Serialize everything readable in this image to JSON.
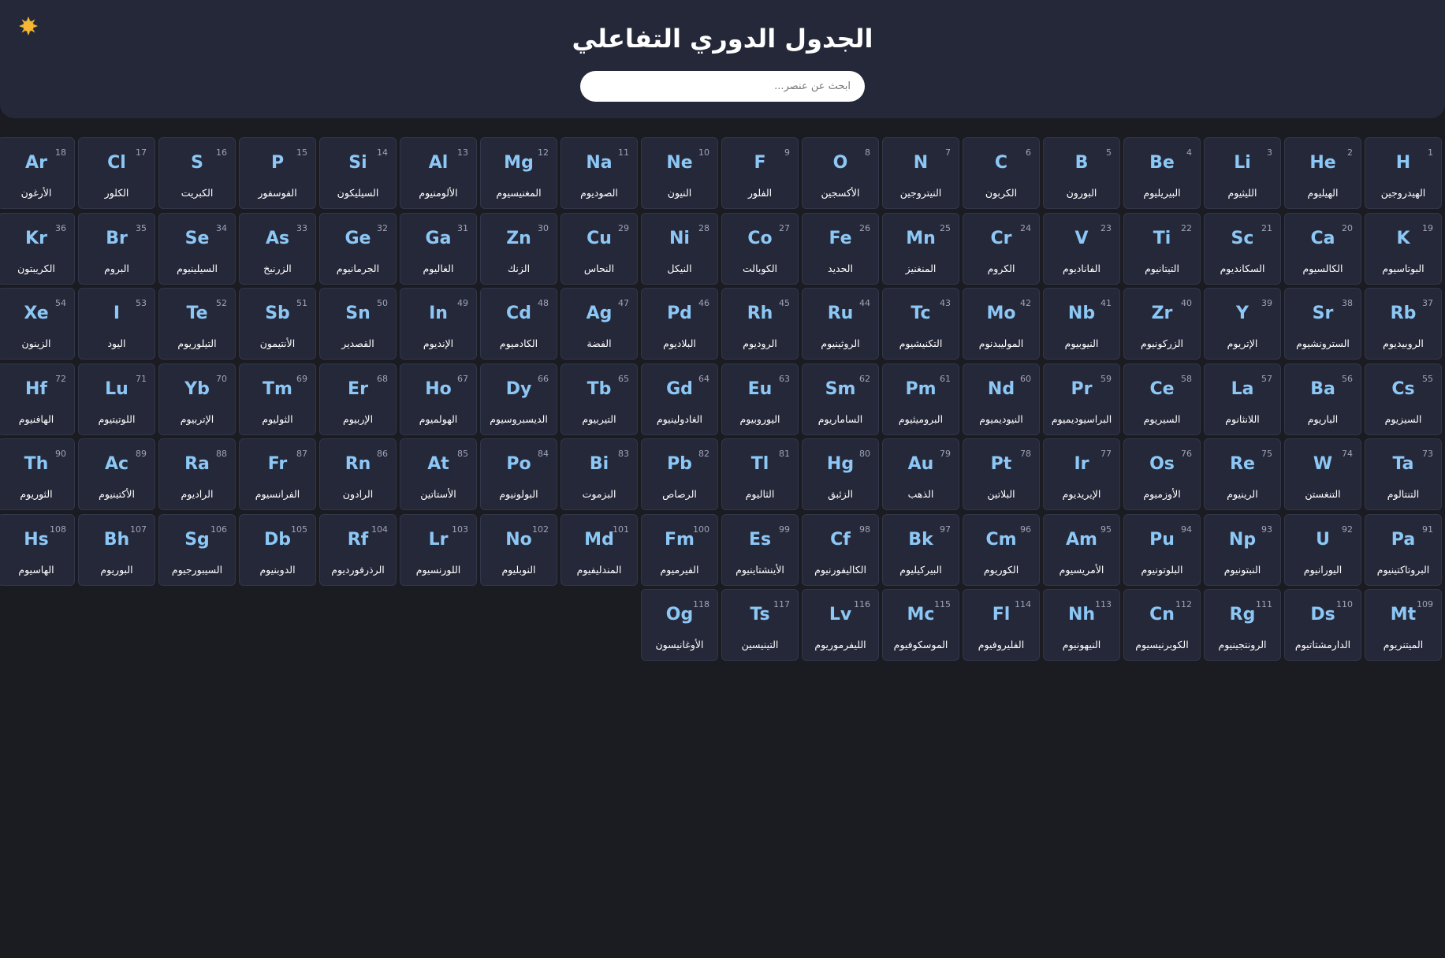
{
  "header": {
    "title": "الجدول الدوري التفاعلي",
    "search_placeholder": "ابحث عن عنصر...",
    "theme_toggle_icon": "sun-icon",
    "accent_color": "#f5b833"
  },
  "colors": {
    "background": "#1b1c22",
    "panel": "#252839",
    "symbol": "#8cc7f5",
    "number": "#a0a4b8"
  },
  "elements": [
    {
      "n": "1",
      "s": "H",
      "a": "الهيدروجين"
    },
    {
      "n": "2",
      "s": "He",
      "a": "الهيليوم"
    },
    {
      "n": "3",
      "s": "Li",
      "a": "الليثيوم"
    },
    {
      "n": "4",
      "s": "Be",
      "a": "البيريليوم"
    },
    {
      "n": "5",
      "s": "B",
      "a": "البورون"
    },
    {
      "n": "6",
      "s": "C",
      "a": "الكربون"
    },
    {
      "n": "7",
      "s": "N",
      "a": "النيتروجين"
    },
    {
      "n": "8",
      "s": "O",
      "a": "الأكسجين"
    },
    {
      "n": "9",
      "s": "F",
      "a": "الفلور"
    },
    {
      "n": "10",
      "s": "Ne",
      "a": "النيون"
    },
    {
      "n": "11",
      "s": "Na",
      "a": "الصوديوم"
    },
    {
      "n": "12",
      "s": "Mg",
      "a": "المغنيسيوم"
    },
    {
      "n": "13",
      "s": "Al",
      "a": "الألومنيوم"
    },
    {
      "n": "14",
      "s": "Si",
      "a": "السيليكون"
    },
    {
      "n": "15",
      "s": "P",
      "a": "الفوسفور"
    },
    {
      "n": "16",
      "s": "S",
      "a": "الكبريت"
    },
    {
      "n": "17",
      "s": "Cl",
      "a": "الكلور"
    },
    {
      "n": "18",
      "s": "Ar",
      "a": "الأرغون"
    },
    {
      "n": "19",
      "s": "K",
      "a": "البوتاسيوم"
    },
    {
      "n": "20",
      "s": "Ca",
      "a": "الكالسيوم"
    },
    {
      "n": "21",
      "s": "Sc",
      "a": "السكانديوم"
    },
    {
      "n": "22",
      "s": "Ti",
      "a": "التيتانيوم"
    },
    {
      "n": "23",
      "s": "V",
      "a": "الفاناديوم"
    },
    {
      "n": "24",
      "s": "Cr",
      "a": "الكروم"
    },
    {
      "n": "25",
      "s": "Mn",
      "a": "المنغنيز"
    },
    {
      "n": "26",
      "s": "Fe",
      "a": "الحديد"
    },
    {
      "n": "27",
      "s": "Co",
      "a": "الكوبالت"
    },
    {
      "n": "28",
      "s": "Ni",
      "a": "النيكل"
    },
    {
      "n": "29",
      "s": "Cu",
      "a": "النحاس"
    },
    {
      "n": "30",
      "s": "Zn",
      "a": "الزنك"
    },
    {
      "n": "31",
      "s": "Ga",
      "a": "الغاليوم"
    },
    {
      "n": "32",
      "s": "Ge",
      "a": "الجرمانيوم"
    },
    {
      "n": "33",
      "s": "As",
      "a": "الزرنيخ"
    },
    {
      "n": "34",
      "s": "Se",
      "a": "السيلينيوم"
    },
    {
      "n": "35",
      "s": "Br",
      "a": "البروم"
    },
    {
      "n": "36",
      "s": "Kr",
      "a": "الكريبتون"
    },
    {
      "n": "37",
      "s": "Rb",
      "a": "الروبيديوم"
    },
    {
      "n": "38",
      "s": "Sr",
      "a": "السترونشيوم"
    },
    {
      "n": "39",
      "s": "Y",
      "a": "الإتريوم"
    },
    {
      "n": "40",
      "s": "Zr",
      "a": "الزركونيوم"
    },
    {
      "n": "41",
      "s": "Nb",
      "a": "النيوبيوم"
    },
    {
      "n": "42",
      "s": "Mo",
      "a": "الموليبدنوم"
    },
    {
      "n": "43",
      "s": "Tc",
      "a": "التكنيشيوم"
    },
    {
      "n": "44",
      "s": "Ru",
      "a": "الروثينيوم"
    },
    {
      "n": "45",
      "s": "Rh",
      "a": "الروديوم"
    },
    {
      "n": "46",
      "s": "Pd",
      "a": "البلاديوم"
    },
    {
      "n": "47",
      "s": "Ag",
      "a": "الفضة"
    },
    {
      "n": "48",
      "s": "Cd",
      "a": "الكادميوم"
    },
    {
      "n": "49",
      "s": "In",
      "a": "الإنديوم"
    },
    {
      "n": "50",
      "s": "Sn",
      "a": "القصدير"
    },
    {
      "n": "51",
      "s": "Sb",
      "a": "الأنتيمون"
    },
    {
      "n": "52",
      "s": "Te",
      "a": "التيلوريوم"
    },
    {
      "n": "53",
      "s": "I",
      "a": "اليود"
    },
    {
      "n": "54",
      "s": "Xe",
      "a": "الزينون"
    },
    {
      "n": "55",
      "s": "Cs",
      "a": "السيزيوم"
    },
    {
      "n": "56",
      "s": "Ba",
      "a": "الباريوم"
    },
    {
      "n": "57",
      "s": "La",
      "a": "اللانثانوم"
    },
    {
      "n": "58",
      "s": "Ce",
      "a": "السيريوم"
    },
    {
      "n": "59",
      "s": "Pr",
      "a": "البراسيوديميوم"
    },
    {
      "n": "60",
      "s": "Nd",
      "a": "النيوديميوم"
    },
    {
      "n": "61",
      "s": "Pm",
      "a": "البروميثيوم"
    },
    {
      "n": "62",
      "s": "Sm",
      "a": "الساماريوم"
    },
    {
      "n": "63",
      "s": "Eu",
      "a": "اليوروبيوم"
    },
    {
      "n": "64",
      "s": "Gd",
      "a": "الغادولينيوم"
    },
    {
      "n": "65",
      "s": "Tb",
      "a": "التيربيوم"
    },
    {
      "n": "66",
      "s": "Dy",
      "a": "الديسبروسيوم"
    },
    {
      "n": "67",
      "s": "Ho",
      "a": "الهولميوم"
    },
    {
      "n": "68",
      "s": "Er",
      "a": "الإربيوم"
    },
    {
      "n": "69",
      "s": "Tm",
      "a": "الثوليوم"
    },
    {
      "n": "70",
      "s": "Yb",
      "a": "الإتربيوم"
    },
    {
      "n": "71",
      "s": "Lu",
      "a": "اللوتيتيوم"
    },
    {
      "n": "72",
      "s": "Hf",
      "a": "الهافنيوم"
    },
    {
      "n": "73",
      "s": "Ta",
      "a": "التنتالوم"
    },
    {
      "n": "74",
      "s": "W",
      "a": "التنغستن"
    },
    {
      "n": "75",
      "s": "Re",
      "a": "الرينيوم"
    },
    {
      "n": "76",
      "s": "Os",
      "a": "الأوزميوم"
    },
    {
      "n": "77",
      "s": "Ir",
      "a": "الإيريديوم"
    },
    {
      "n": "78",
      "s": "Pt",
      "a": "البلاتين"
    },
    {
      "n": "79",
      "s": "Au",
      "a": "الذهب"
    },
    {
      "n": "80",
      "s": "Hg",
      "a": "الزئبق"
    },
    {
      "n": "81",
      "s": "Tl",
      "a": "الثاليوم"
    },
    {
      "n": "82",
      "s": "Pb",
      "a": "الرصاص"
    },
    {
      "n": "83",
      "s": "Bi",
      "a": "البزموت"
    },
    {
      "n": "84",
      "s": "Po",
      "a": "البولونيوم"
    },
    {
      "n": "85",
      "s": "At",
      "a": "الأستاتين"
    },
    {
      "n": "86",
      "s": "Rn",
      "a": "الرادون"
    },
    {
      "n": "87",
      "s": "Fr",
      "a": "الفرانسيوم"
    },
    {
      "n": "88",
      "s": "Ra",
      "a": "الراديوم"
    },
    {
      "n": "89",
      "s": "Ac",
      "a": "الأكتينيوم"
    },
    {
      "n": "90",
      "s": "Th",
      "a": "الثوريوم"
    },
    {
      "n": "91",
      "s": "Pa",
      "a": "البروتاكتينيوم"
    },
    {
      "n": "92",
      "s": "U",
      "a": "اليورانيوم"
    },
    {
      "n": "93",
      "s": "Np",
      "a": "النبتونيوم"
    },
    {
      "n": "94",
      "s": "Pu",
      "a": "البلوتونيوم"
    },
    {
      "n": "95",
      "s": "Am",
      "a": "الأمريسيوم"
    },
    {
      "n": "96",
      "s": "Cm",
      "a": "الكوريوم"
    },
    {
      "n": "97",
      "s": "Bk",
      "a": "البيركيليوم"
    },
    {
      "n": "98",
      "s": "Cf",
      "a": "الكاليفورنيوم"
    },
    {
      "n": "99",
      "s": "Es",
      "a": "الأينشتاينيوم"
    },
    {
      "n": "100",
      "s": "Fm",
      "a": "الفيرميوم"
    },
    {
      "n": "101",
      "s": "Md",
      "a": "المندليفيوم"
    },
    {
      "n": "102",
      "s": "No",
      "a": "النوبليوم"
    },
    {
      "n": "103",
      "s": "Lr",
      "a": "اللورنسيوم"
    },
    {
      "n": "104",
      "s": "Rf",
      "a": "الرذرفورديوم"
    },
    {
      "n": "105",
      "s": "Db",
      "a": "الدوبنيوم"
    },
    {
      "n": "106",
      "s": "Sg",
      "a": "السيبورجيوم"
    },
    {
      "n": "107",
      "s": "Bh",
      "a": "البوريوم"
    },
    {
      "n": "108",
      "s": "Hs",
      "a": "الهاسيوم"
    },
    {
      "n": "109",
      "s": "Mt",
      "a": "الميتنريوم"
    },
    {
      "n": "110",
      "s": "Ds",
      "a": "الدارمشتاتيوم"
    },
    {
      "n": "111",
      "s": "Rg",
      "a": "الرونتجينيوم"
    },
    {
      "n": "112",
      "s": "Cn",
      "a": "الكوبرنيسيوم"
    },
    {
      "n": "113",
      "s": "Nh",
      "a": "النيهونيوم"
    },
    {
      "n": "114",
      "s": "Fl",
      "a": "الفليروفيوم"
    },
    {
      "n": "115",
      "s": "Mc",
      "a": "الموسكوفيوم"
    },
    {
      "n": "116",
      "s": "Lv",
      "a": "الليفرموريوم"
    },
    {
      "n": "117",
      "s": "Ts",
      "a": "التينيسين"
    },
    {
      "n": "118",
      "s": "Og",
      "a": "الأوغانيسون"
    }
  ]
}
